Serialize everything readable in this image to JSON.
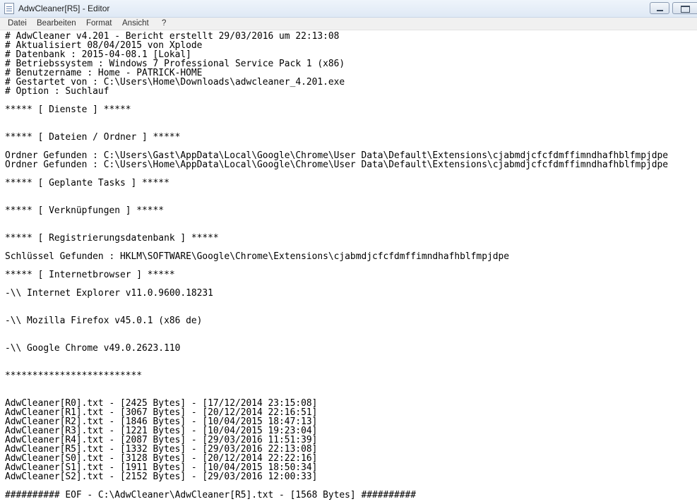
{
  "window": {
    "title": "AdwCleaner[R5] - Editor"
  },
  "menu": {
    "items": [
      "Datei",
      "Bearbeiten",
      "Format",
      "Ansicht",
      "?"
    ]
  },
  "editor": {
    "lines": [
      "# AdwCleaner v4.201 - Bericht erstellt 29/03/2016 um 22:13:08",
      "# Aktualisiert 08/04/2015 von Xplode",
      "# Datenbank : 2015-04-08.1 [Lokal]",
      "# Betriebssystem : Windows 7 Professional Service Pack 1 (x86)",
      "# Benutzername : Home - PATRICK-HOME",
      "# Gestartet von : C:\\Users\\Home\\Downloads\\adwcleaner_4.201.exe",
      "# Option : Suchlauf",
      "",
      "***** [ Dienste ] *****",
      "",
      "",
      "***** [ Dateien / Ordner ] *****",
      "",
      "Ordner Gefunden : C:\\Users\\Gast\\AppData\\Local\\Google\\Chrome\\User Data\\Default\\Extensions\\cjabmdjcfcfdmffimndhafhblfmpjdpe",
      "Ordner Gefunden : C:\\Users\\Home\\AppData\\Local\\Google\\Chrome\\User Data\\Default\\Extensions\\cjabmdjcfcfdmffimndhafhblfmpjdpe",
      "",
      "***** [ Geplante Tasks ] *****",
      "",
      "",
      "***** [ Verknüpfungen ] *****",
      "",
      "",
      "***** [ Registrierungsdatenbank ] *****",
      "",
      "Schlüssel Gefunden : HKLM\\SOFTWARE\\Google\\Chrome\\Extensions\\cjabmdjcfcfdmffimndhafhblfmpjdpe",
      "",
      "***** [ Internetbrowser ] *****",
      "",
      "-\\\\ Internet Explorer v11.0.9600.18231",
      "",
      "",
      "-\\\\ Mozilla Firefox v45.0.1 (x86 de)",
      "",
      "",
      "-\\\\ Google Chrome v49.0.2623.110",
      "",
      "",
      "*************************",
      "",
      "",
      "AdwCleaner[R0].txt - [2425 Bytes] - [17/12/2014 23:15:08]",
      "AdwCleaner[R1].txt - [3067 Bytes] - [20/12/2014 22:16:51]",
      "AdwCleaner[R2].txt - [1846 Bytes] - [10/04/2015 18:47:13]",
      "AdwCleaner[R3].txt - [1221 Bytes] - [10/04/2015 19:23:04]",
      "AdwCleaner[R4].txt - [2087 Bytes] - [29/03/2016 11:51:39]",
      "AdwCleaner[R5].txt - [1332 Bytes] - [29/03/2016 22:13:08]",
      "AdwCleaner[S0].txt - [3128 Bytes] - [20/12/2014 22:22:16]",
      "AdwCleaner[S1].txt - [1911 Bytes] - [10/04/2015 18:50:34]",
      "AdwCleaner[S2].txt - [2152 Bytes] - [29/03/2016 12:00:33]",
      "",
      "########## EOF - C:\\AdwCleaner\\AdwCleaner[R5].txt - [1568 Bytes] ##########"
    ]
  }
}
